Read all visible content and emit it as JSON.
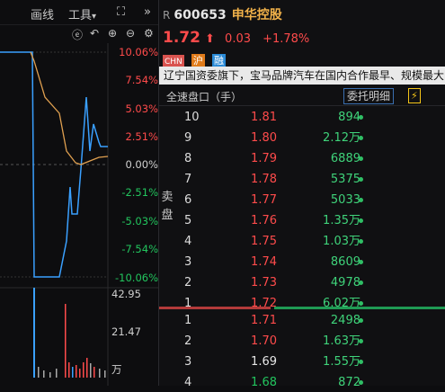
{
  "toolbar": {
    "draw_label": "画线",
    "tools_label": "工具",
    "tools_caret": "▾",
    "fullscreen_glyph": "⛶",
    "more_glyph": "»"
  },
  "chart_icons": {
    "copyright": "ⓔ",
    "undo": "↶",
    "zoom_in": "⊕",
    "zoom_out": "⊖",
    "settings": "⚙"
  },
  "chart_axis": {
    "pct_labels": [
      "10.06%",
      "7.54%",
      "5.03%",
      "2.51%",
      "0.00%",
      "-2.51%",
      "-5.03%",
      "-7.54%",
      "-10.06%"
    ],
    "pct_colors": [
      "#ff4b4b",
      "#ff4b4b",
      "#ff4b4b",
      "#ff4b4b",
      "#d0d0d0",
      "#22c55e",
      "#22c55e",
      "#22c55e",
      "#22c55e"
    ],
    "vol_labels": [
      "42.95",
      "21.47",
      "万"
    ]
  },
  "stock": {
    "market_tag": "R",
    "code": "600653",
    "name": "申华控股",
    "price": "1.72",
    "arrow": "⬆",
    "change": "0.03",
    "change_pct": "+1.78%"
  },
  "badges": [
    {
      "text": "CHN",
      "color": "#d9534f"
    },
    {
      "text": "沪",
      "color": "#e07b1a"
    },
    {
      "text": "融",
      "color": "#2a8ad6"
    }
  ],
  "news": "辽宁国资委旗下，宝马品牌汽车在国内合作最早、规模最大的",
  "panel": {
    "title": "全速盘口（手）",
    "entrust_label": "委托明细",
    "flash_glyph": "⚡",
    "sell_label": "卖盘"
  },
  "asks": [
    {
      "level": "10",
      "price": "1.81",
      "vol": "894"
    },
    {
      "level": "9",
      "price": "1.80",
      "vol": "2.12万"
    },
    {
      "level": "8",
      "price": "1.79",
      "vol": "6889"
    },
    {
      "level": "7",
      "price": "1.78",
      "vol": "5375"
    },
    {
      "level": "6",
      "price": "1.77",
      "vol": "5033"
    },
    {
      "level": "5",
      "price": "1.76",
      "vol": "1.35万"
    },
    {
      "level": "4",
      "price": "1.75",
      "vol": "1.03万"
    },
    {
      "level": "3",
      "price": "1.74",
      "vol": "8609"
    },
    {
      "level": "2",
      "price": "1.73",
      "vol": "4978"
    },
    {
      "level": "1",
      "price": "1.72",
      "vol": "6.02万"
    }
  ],
  "bids": [
    {
      "level": "1",
      "price": "1.71",
      "vol": "2498",
      "color": "#ff4b4b"
    },
    {
      "level": "2",
      "price": "1.70",
      "vol": "1.63万",
      "color": "#ff4b4b"
    },
    {
      "level": "3",
      "price": "1.69",
      "vol": "1.55万",
      "color": "#e6e6e6"
    },
    {
      "level": "4",
      "price": "1.68",
      "vol": "872",
      "color": "#22c55e"
    }
  ]
}
